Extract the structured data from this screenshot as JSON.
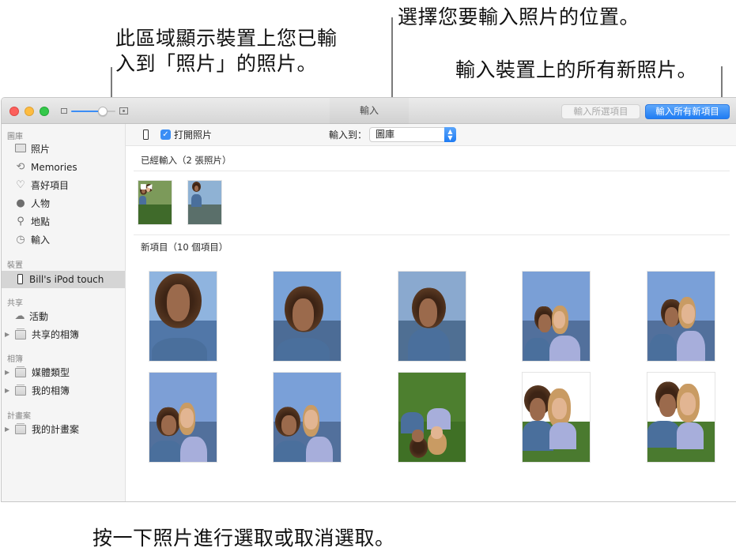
{
  "callouts": {
    "imported_area": [
      "此區域顯示裝置上您已輸",
      "入到「照片」的照片。"
    ],
    "import_destination": "選擇您要輸入照片的位置。",
    "import_all": "輸入裝置上的所有新照片。",
    "click_photos": "按一下照片進行選取或取消選取。"
  },
  "window": {
    "title": "輸入",
    "buttons": {
      "import_selected": "輸入所選項目",
      "import_all_new": "輸入所有新項目"
    },
    "thumbnail_zoom_level": 0.72
  },
  "sidebar": {
    "sections": [
      {
        "header": "圖庫",
        "items": [
          {
            "label": "照片",
            "icon": "photos-icon"
          },
          {
            "label": "Memories",
            "icon": "memories-icon"
          },
          {
            "label": "喜好項目",
            "icon": "heart-icon"
          },
          {
            "label": "人物",
            "icon": "person-icon"
          },
          {
            "label": "地點",
            "icon": "pin-icon"
          },
          {
            "label": "輸入",
            "icon": "clock-icon"
          }
        ]
      },
      {
        "header": "裝置",
        "items": [
          {
            "label": "Bill's iPod touch",
            "icon": "device-icon",
            "selected": true
          }
        ]
      },
      {
        "header": "共享",
        "items": [
          {
            "label": "活動",
            "icon": "cloud-icon"
          },
          {
            "label": "共享的相簿",
            "icon": "album-icon",
            "disclosure": true
          }
        ]
      },
      {
        "header": "相簿",
        "items": [
          {
            "label": "媒體類型",
            "icon": "album-icon",
            "disclosure": true
          },
          {
            "label": "我的相簿",
            "icon": "album-icon",
            "disclosure": true
          }
        ]
      },
      {
        "header": "計畫案",
        "items": [
          {
            "label": "我的計畫案",
            "icon": "album-icon",
            "disclosure": true
          }
        ]
      }
    ]
  },
  "toolbar": {
    "open_photos_label": "打開照片",
    "open_photos_checked": true,
    "import_to_label": "輸入到：",
    "import_to_value": "圖庫"
  },
  "sections": {
    "already_imported": {
      "title": "已經輸入（2 張照片）",
      "photos": [
        {
          "name": "two-girls-lying-grass",
          "video": true
        },
        {
          "name": "girl-by-sea"
        }
      ]
    },
    "new_items": {
      "title": "新項目（10 個項目）",
      "photos": [
        {
          "name": "girl-looking-up"
        },
        {
          "name": "girl-flowers-on-eyes"
        },
        {
          "name": "girl-smiling-sea"
        },
        {
          "name": "two-girls-sunglasses-kiss"
        },
        {
          "name": "two-girls-sunglasses-peace"
        },
        {
          "name": "two-girls-selfie"
        },
        {
          "name": "two-girls-peace-sign"
        },
        {
          "name": "two-girls-lying-overhead"
        },
        {
          "name": "two-girls-flower-mouth"
        },
        {
          "name": "two-girls-lying-smile"
        }
      ]
    }
  }
}
